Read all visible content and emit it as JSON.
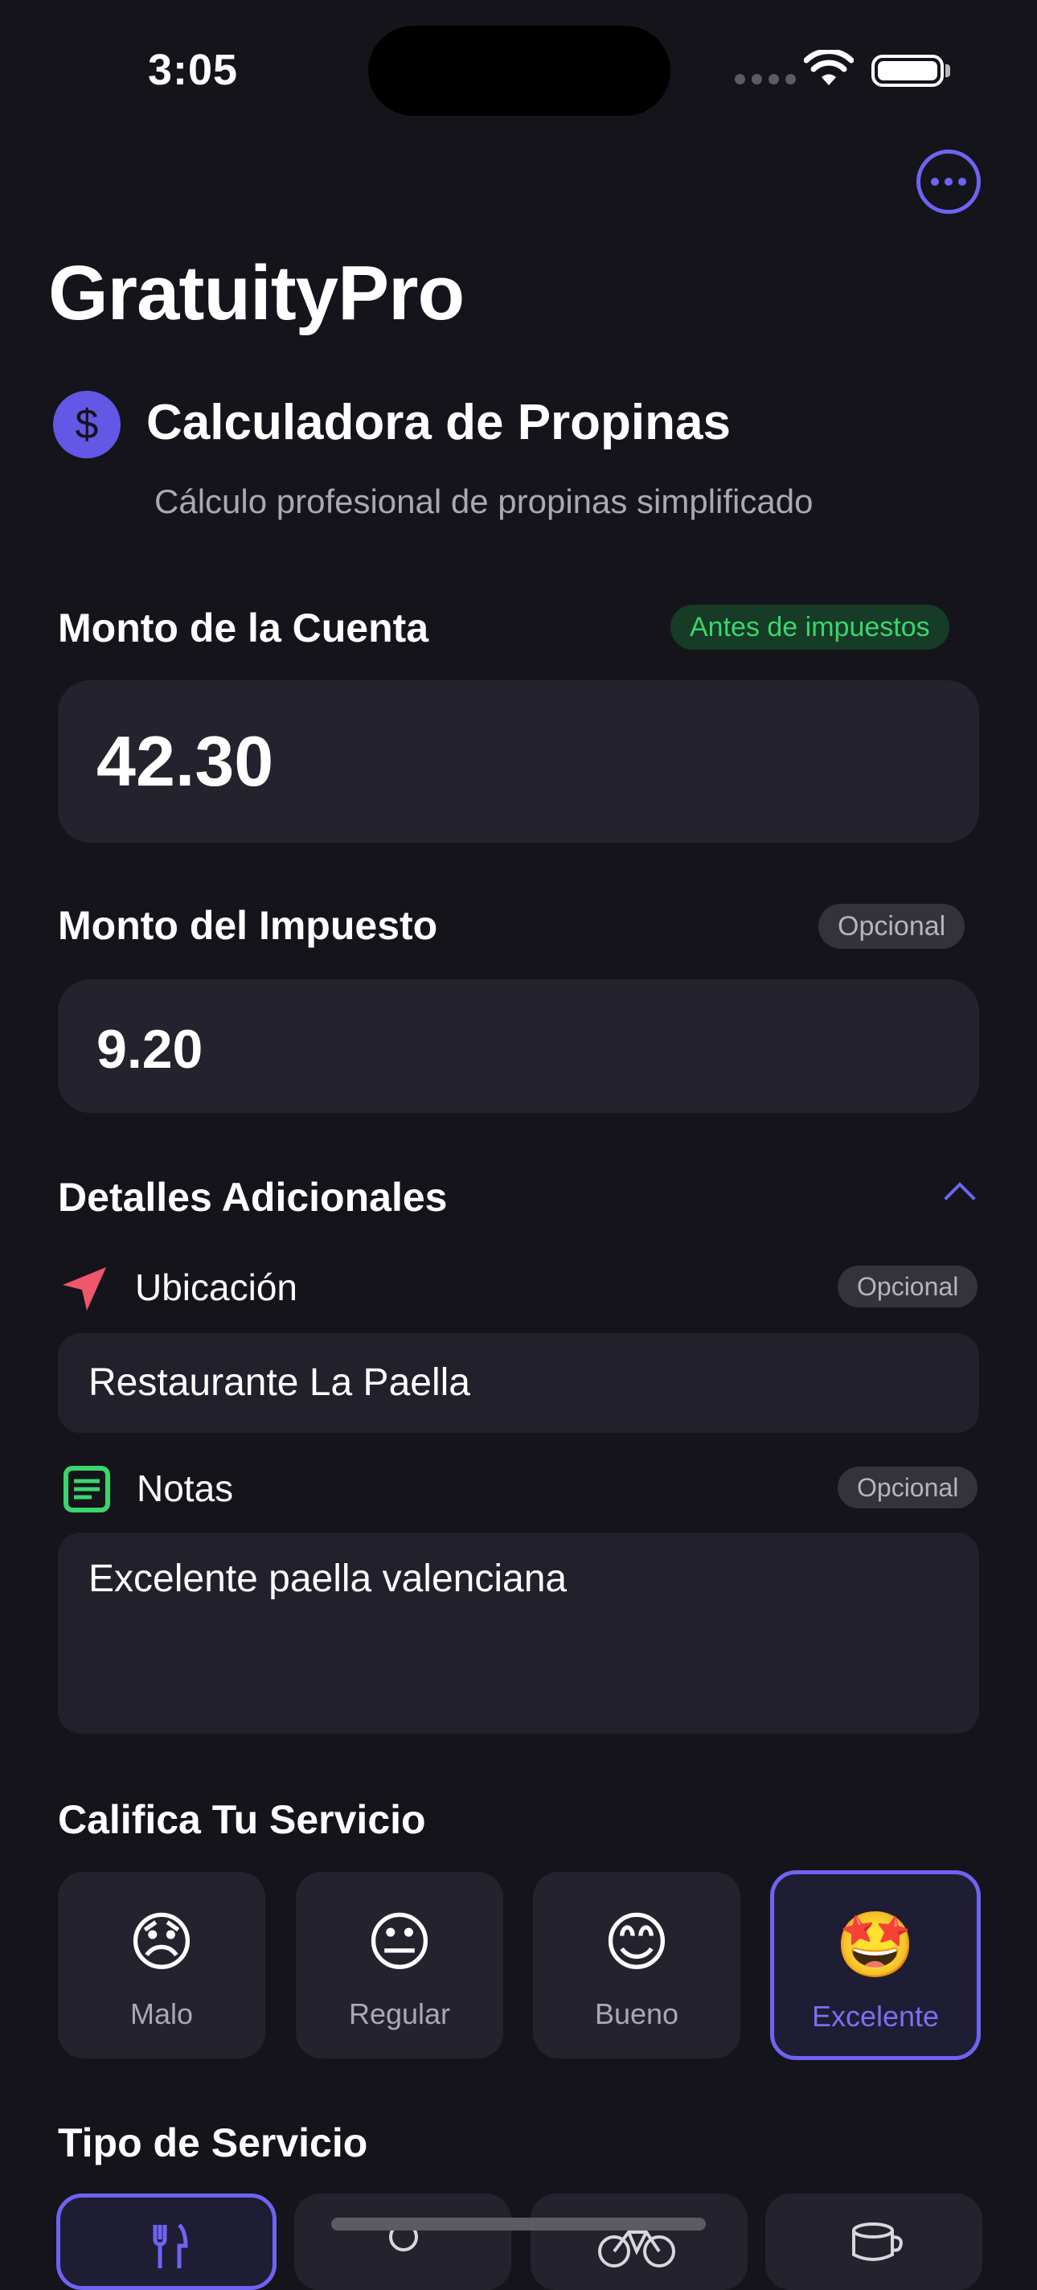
{
  "status_bar": {
    "time": "3:05"
  },
  "app": {
    "title": "GratuityPro"
  },
  "header": {
    "icon": "dollar-icon",
    "title": "Calculadora de Propinas",
    "subtitle": "Cálculo profesional de propinas simplificado"
  },
  "bill": {
    "label": "Monto de la Cuenta",
    "badge": "Antes de impuestos",
    "value": "42.30"
  },
  "tax": {
    "label": "Monto del Impuesto",
    "badge": "Opcional",
    "value": "9.20"
  },
  "details": {
    "title": "Detalles Adicionales",
    "location": {
      "label": "Ubicación",
      "badge": "Opcional",
      "value": "Restaurante La Paella",
      "icon": "location-arrow-icon"
    },
    "notes": {
      "label": "Notas",
      "badge": "Opcional",
      "value": "Excelente paella valenciana",
      "icon": "notes-icon"
    }
  },
  "rating": {
    "title": "Califica Tu Servicio",
    "options": [
      {
        "emoji": "😞",
        "label": "Malo"
      },
      {
        "emoji": "😐",
        "label": "Regular"
      },
      {
        "emoji": "😊",
        "label": "Bueno"
      },
      {
        "emoji": "🤩",
        "label": "Excelente"
      }
    ],
    "selected": "Excelente"
  },
  "service_type": {
    "title": "Tipo de Servicio",
    "icons": [
      "fork-knife-icon",
      "person-icon",
      "bicycle-icon",
      "cup-icon"
    ]
  },
  "colors": {
    "accent": "#6f63f3",
    "background": "#15141b",
    "card": "#24232d",
    "green": "#3ad66c",
    "location": "#f0566e"
  }
}
